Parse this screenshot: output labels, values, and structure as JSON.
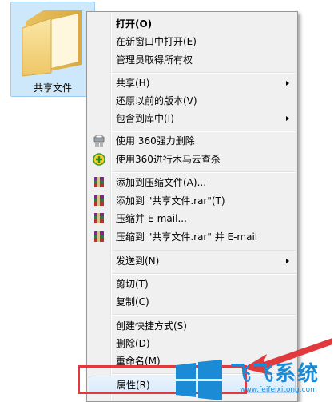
{
  "folder": {
    "label": "共享文件",
    "icon": "folder-icon"
  },
  "menu": {
    "items": [
      {
        "label": "打开(O)",
        "bold": true
      },
      {
        "label": "在新窗口中打开(E)"
      },
      {
        "label": "管理员取得所有权"
      },
      {
        "label": "共享(H)",
        "submenu": true
      },
      {
        "label": "还原以前的版本(V)"
      },
      {
        "label": "包含到库中(I)",
        "submenu": true
      },
      {
        "label": "使用 360强力删除",
        "icon": "360-shred-icon"
      },
      {
        "label": "使用360进行木马云查杀",
        "icon": "360-scan-icon"
      },
      {
        "label": "添加到压缩文件(A)...",
        "icon": "winrar-icon"
      },
      {
        "label": "添加到 \"共享文件.rar\"(T)",
        "icon": "winrar-icon"
      },
      {
        "label": "压缩并 E-mail...",
        "icon": "winrar-icon"
      },
      {
        "label": "压缩到 \"共享文件.rar\" 并 E-mail",
        "icon": "winrar-icon"
      },
      {
        "label": "发送到(N)",
        "submenu": true
      },
      {
        "label": "剪切(T)"
      },
      {
        "label": "复制(C)"
      },
      {
        "label": "创建快捷方式(S)"
      },
      {
        "label": "删除(D)"
      },
      {
        "label": "重命名(M)"
      },
      {
        "label": "属性(R)"
      }
    ]
  },
  "watermark": {
    "title": "飞飞系统",
    "url": "www.feifeixitong.com"
  },
  "colors": {
    "highlight": "#e0393e",
    "brand": "#1c8bd6"
  }
}
